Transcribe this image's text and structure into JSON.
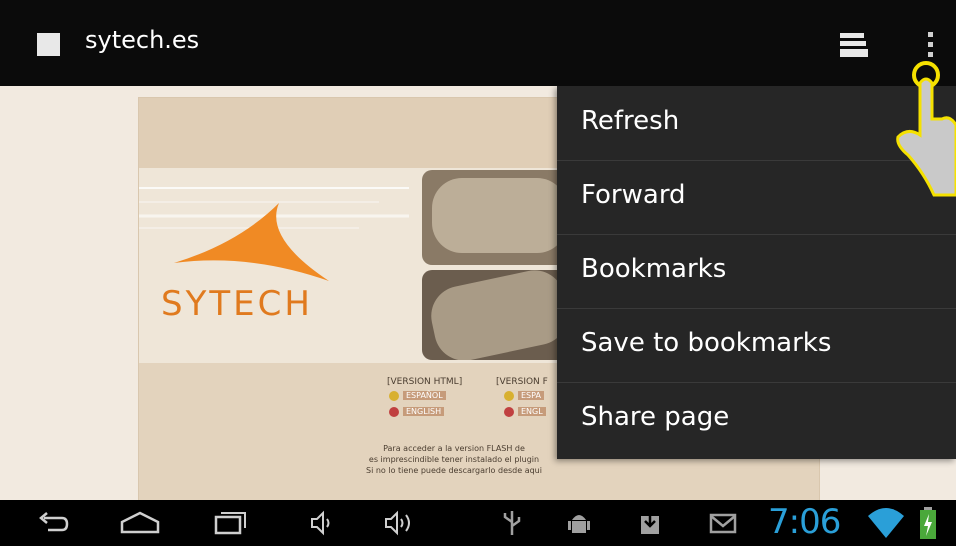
{
  "browser": {
    "title": "sytech.es",
    "tabs_icon": "tabs-icon",
    "overflow_icon": "overflow-menu-icon"
  },
  "webpage": {
    "logo_text": "SYTECH",
    "version_html_label": "[VERSION HTML]",
    "version_flash_label": "[VERSION F",
    "html_spanish": "ESPAÑOL",
    "html_english": "ENGLISH",
    "flash_spanish": "ESPA",
    "flash_english": "ENGL",
    "footer_line1": "Para acceder a la version FLASH de",
    "footer_line2": "es imprescindible tener instalado el plugin",
    "footer_line3": "Si no lo tiene puede descargarlo desde aqui"
  },
  "menu": {
    "items": [
      {
        "label": "Refresh"
      },
      {
        "label": "Forward"
      },
      {
        "label": "Bookmarks"
      },
      {
        "label": "Save to bookmarks"
      },
      {
        "label": "Share page"
      }
    ]
  },
  "navbar": {
    "back_icon": "back-icon",
    "home_icon": "home-icon",
    "recents_icon": "recent-apps-icon",
    "volume_down_icon": "volume-down-icon",
    "volume_up_icon": "volume-up-icon",
    "usb_icon": "usb-icon",
    "android_debug_icon": "android-debug-icon",
    "download_icon": "download-icon",
    "gmail_icon": "gmail-icon",
    "wifi_icon": "wifi-icon",
    "battery_icon": "battery-icon",
    "time": "7:06"
  },
  "colors": {
    "clock": "#2a9fd8",
    "menu_bg": "#262626",
    "logo_orange": "#e07a1e",
    "hand_outline": "#f5e100"
  }
}
